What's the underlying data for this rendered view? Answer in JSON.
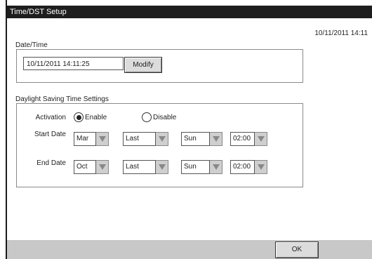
{
  "window": {
    "title": "Time/DST Setup"
  },
  "clock": "10/11/2011 14:11",
  "datetime": {
    "section_label": "Date/Time",
    "value": "10/11/2011 14:11:25",
    "modify_label": "Modify"
  },
  "dst": {
    "section_label": "Daylight Saving Time Settings",
    "activation": {
      "label": "Activation",
      "enable_label": "Enable",
      "disable_label": "Disable",
      "selected": "Enable"
    },
    "start": {
      "label": "Start Date",
      "month": "Mar",
      "week": "Last",
      "day": "Sun",
      "time": "02:00"
    },
    "end": {
      "label": "End Date",
      "month": "Oct",
      "week": "Last",
      "day": "Sun",
      "time": "02:00"
    }
  },
  "footer": {
    "ok_label": "OK"
  },
  "icons": {
    "dropdown": "triangle-down-icon",
    "radio_selected": "radio-selected-icon",
    "radio_unselected": "radio-unselected-icon"
  },
  "colors": {
    "titlebar": "#1e1e1e",
    "footer": "#c8c8c8",
    "button": "#dcdcdc",
    "dropdown_arrow": "#cfcfcf"
  }
}
